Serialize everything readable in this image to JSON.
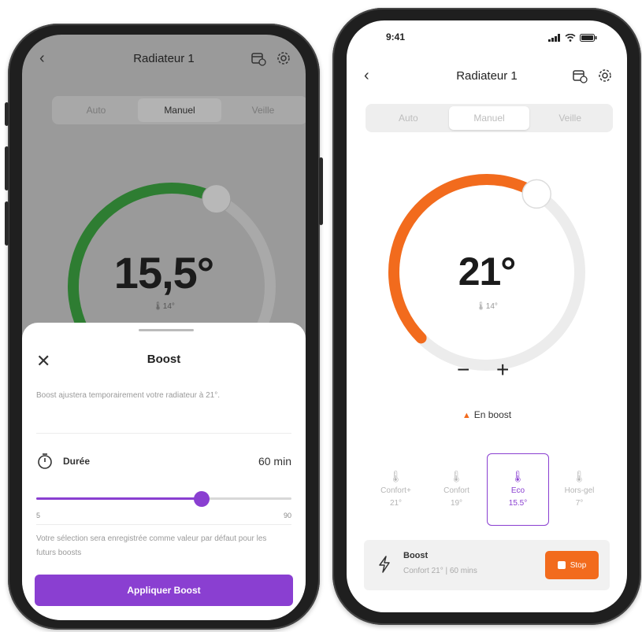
{
  "left_screen": {
    "header": {
      "title": "Radiateur 1"
    },
    "modes": [
      "Auto",
      "Manuel",
      "Veille"
    ],
    "active_mode": "Manuel",
    "temperature": "15,5°",
    "sub_temperature": "🌡14°",
    "dial_color": "#2e7d32",
    "dial_level": 0.6,
    "boost_sheet": {
      "title": "Boost",
      "description": "Boost ajustera temporairement votre radiateur à 21°.",
      "duration_label": "Durée",
      "duration_value": "60 min",
      "slider_min": "5",
      "slider_max": "90",
      "slider_value": 60,
      "note": "Votre sélection sera enregistrée comme valeur par défaut pour les futurs boosts",
      "apply_label": "Appliquer Boost"
    }
  },
  "right_screen": {
    "status_bar": {
      "time": "9:41"
    },
    "header": {
      "title": "Radiateur 1"
    },
    "modes": [
      "Auto",
      "Manuel",
      "Veille"
    ],
    "active_mode": "Manuel",
    "temperature": "21°",
    "sub_temperature": "🌡14°",
    "dial_color": "#f26b1d",
    "dial_level": 0.62,
    "minus_label": "−",
    "plus_label": "+",
    "boost_status": "En boost",
    "presets": [
      {
        "name": "Confort+",
        "value": "21°",
        "icon": "thermometer-plus-icon"
      },
      {
        "name": "Confort",
        "value": "19°",
        "icon": "thermometer-icon"
      },
      {
        "name": "Eco",
        "value": "15.5°",
        "icon": "eco-thermometer-icon"
      },
      {
        "name": "Hors-gel",
        "value": "7°",
        "icon": "frost-thermometer-icon"
      }
    ],
    "active_preset": "Eco",
    "boost_card": {
      "title": "Boost",
      "subtitle": "Confort 21° | 60 mins",
      "stop_label": "Stop"
    },
    "accent_color": "#f26b1d",
    "purple_accent": "#8a3fd1"
  }
}
